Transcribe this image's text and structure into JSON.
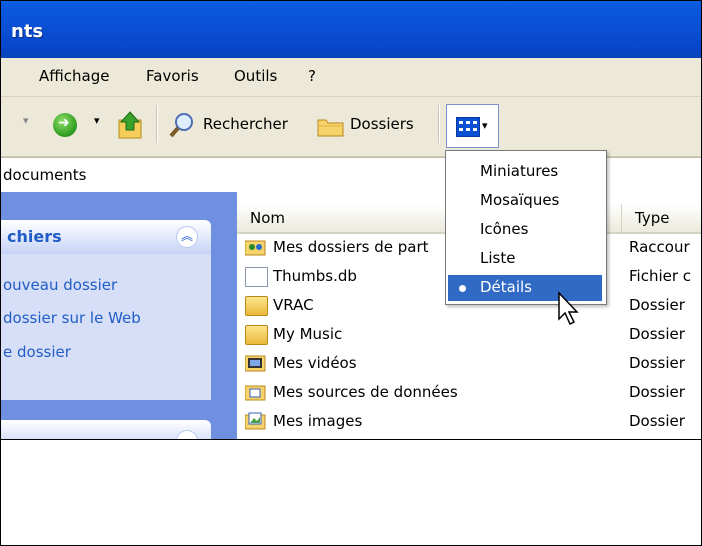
{
  "window": {
    "title_fragment": "nts"
  },
  "menubar": [
    "Affichage",
    "Favoris",
    "Outils",
    "?"
  ],
  "toolbar": {
    "search_label": "Rechercher",
    "folders_label": "Dossiers"
  },
  "address": {
    "value": "documents"
  },
  "left_pane": {
    "section_title": "chiers",
    "tasks": [
      "ouveau dossier",
      "dossier sur le Web",
      "e dossier"
    ]
  },
  "file_list": {
    "columns": [
      "Nom",
      "Type"
    ],
    "rows": [
      {
        "name": "Mes dossiers de part",
        "type": "Raccour",
        "icon": "shared-folder-icon"
      },
      {
        "name": "Thumbs.db",
        "type": "Fichier c",
        "icon": "file-icon"
      },
      {
        "name": "VRAC",
        "type": "Dossier",
        "icon": "folder-icon"
      },
      {
        "name": "My Music",
        "type": "Dossier",
        "icon": "folder-icon"
      },
      {
        "name": "Mes vidéos",
        "type": "Dossier",
        "icon": "video-folder-icon"
      },
      {
        "name": "Mes sources de données",
        "type": "Dossier",
        "icon": "data-folder-icon"
      },
      {
        "name": "Mes images",
        "type": "Dossier",
        "icon": "image-folder-icon"
      }
    ]
  },
  "views_menu": {
    "items": [
      "Miniatures",
      "Mosaïques",
      "Icônes",
      "Liste",
      "Détails"
    ],
    "selected": "Détails"
  },
  "colors": {
    "title_bar": "#0a4fd4",
    "selection": "#316ac5",
    "link": "#215dc6"
  }
}
